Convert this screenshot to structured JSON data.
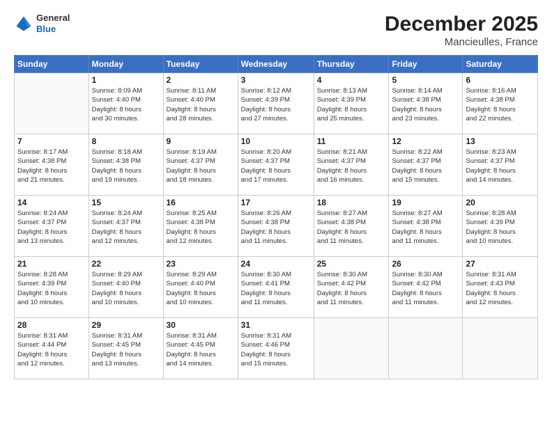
{
  "header": {
    "logo_general": "General",
    "logo_blue": "Blue",
    "month": "December 2025",
    "location": "Mancieulles, France"
  },
  "weekdays": [
    "Sunday",
    "Monday",
    "Tuesday",
    "Wednesday",
    "Thursday",
    "Friday",
    "Saturday"
  ],
  "weeks": [
    [
      {
        "day": "",
        "info": ""
      },
      {
        "day": "1",
        "info": "Sunrise: 8:09 AM\nSunset: 4:40 PM\nDaylight: 8 hours\nand 30 minutes."
      },
      {
        "day": "2",
        "info": "Sunrise: 8:11 AM\nSunset: 4:40 PM\nDaylight: 8 hours\nand 28 minutes."
      },
      {
        "day": "3",
        "info": "Sunrise: 8:12 AM\nSunset: 4:39 PM\nDaylight: 8 hours\nand 27 minutes."
      },
      {
        "day": "4",
        "info": "Sunrise: 8:13 AM\nSunset: 4:39 PM\nDaylight: 8 hours\nand 25 minutes."
      },
      {
        "day": "5",
        "info": "Sunrise: 8:14 AM\nSunset: 4:38 PM\nDaylight: 8 hours\nand 23 minutes."
      },
      {
        "day": "6",
        "info": "Sunrise: 8:16 AM\nSunset: 4:38 PM\nDaylight: 8 hours\nand 22 minutes."
      }
    ],
    [
      {
        "day": "7",
        "info": "Sunrise: 8:17 AM\nSunset: 4:38 PM\nDaylight: 8 hours\nand 21 minutes."
      },
      {
        "day": "8",
        "info": "Sunrise: 8:18 AM\nSunset: 4:38 PM\nDaylight: 8 hours\nand 19 minutes."
      },
      {
        "day": "9",
        "info": "Sunrise: 8:19 AM\nSunset: 4:37 PM\nDaylight: 8 hours\nand 18 minutes."
      },
      {
        "day": "10",
        "info": "Sunrise: 8:20 AM\nSunset: 4:37 PM\nDaylight: 8 hours\nand 17 minutes."
      },
      {
        "day": "11",
        "info": "Sunrise: 8:21 AM\nSunset: 4:37 PM\nDaylight: 8 hours\nand 16 minutes."
      },
      {
        "day": "12",
        "info": "Sunrise: 8:22 AM\nSunset: 4:37 PM\nDaylight: 8 hours\nand 15 minutes."
      },
      {
        "day": "13",
        "info": "Sunrise: 8:23 AM\nSunset: 4:37 PM\nDaylight: 8 hours\nand 14 minutes."
      }
    ],
    [
      {
        "day": "14",
        "info": "Sunrise: 8:24 AM\nSunset: 4:37 PM\nDaylight: 8 hours\nand 13 minutes."
      },
      {
        "day": "15",
        "info": "Sunrise: 8:24 AM\nSunset: 4:37 PM\nDaylight: 8 hours\nand 12 minutes."
      },
      {
        "day": "16",
        "info": "Sunrise: 8:25 AM\nSunset: 4:38 PM\nDaylight: 8 hours\nand 12 minutes."
      },
      {
        "day": "17",
        "info": "Sunrise: 8:26 AM\nSunset: 4:38 PM\nDaylight: 8 hours\nand 11 minutes."
      },
      {
        "day": "18",
        "info": "Sunrise: 8:27 AM\nSunset: 4:38 PM\nDaylight: 8 hours\nand 11 minutes."
      },
      {
        "day": "19",
        "info": "Sunrise: 8:27 AM\nSunset: 4:38 PM\nDaylight: 8 hours\nand 11 minutes."
      },
      {
        "day": "20",
        "info": "Sunrise: 8:28 AM\nSunset: 4:39 PM\nDaylight: 8 hours\nand 10 minutes."
      }
    ],
    [
      {
        "day": "21",
        "info": "Sunrise: 8:28 AM\nSunset: 4:39 PM\nDaylight: 8 hours\nand 10 minutes."
      },
      {
        "day": "22",
        "info": "Sunrise: 8:29 AM\nSunset: 4:40 PM\nDaylight: 8 hours\nand 10 minutes."
      },
      {
        "day": "23",
        "info": "Sunrise: 8:29 AM\nSunset: 4:40 PM\nDaylight: 8 hours\nand 10 minutes."
      },
      {
        "day": "24",
        "info": "Sunrise: 8:30 AM\nSunset: 4:41 PM\nDaylight: 8 hours\nand 11 minutes."
      },
      {
        "day": "25",
        "info": "Sunrise: 8:30 AM\nSunset: 4:42 PM\nDaylight: 8 hours\nand 11 minutes."
      },
      {
        "day": "26",
        "info": "Sunrise: 8:30 AM\nSunset: 4:42 PM\nDaylight: 8 hours\nand 11 minutes."
      },
      {
        "day": "27",
        "info": "Sunrise: 8:31 AM\nSunset: 4:43 PM\nDaylight: 8 hours\nand 12 minutes."
      }
    ],
    [
      {
        "day": "28",
        "info": "Sunrise: 8:31 AM\nSunset: 4:44 PM\nDaylight: 8 hours\nand 12 minutes."
      },
      {
        "day": "29",
        "info": "Sunrise: 8:31 AM\nSunset: 4:45 PM\nDaylight: 8 hours\nand 13 minutes."
      },
      {
        "day": "30",
        "info": "Sunrise: 8:31 AM\nSunset: 4:45 PM\nDaylight: 8 hours\nand 14 minutes."
      },
      {
        "day": "31",
        "info": "Sunrise: 8:31 AM\nSunset: 4:46 PM\nDaylight: 8 hours\nand 15 minutes."
      },
      {
        "day": "",
        "info": ""
      },
      {
        "day": "",
        "info": ""
      },
      {
        "day": "",
        "info": ""
      }
    ]
  ]
}
